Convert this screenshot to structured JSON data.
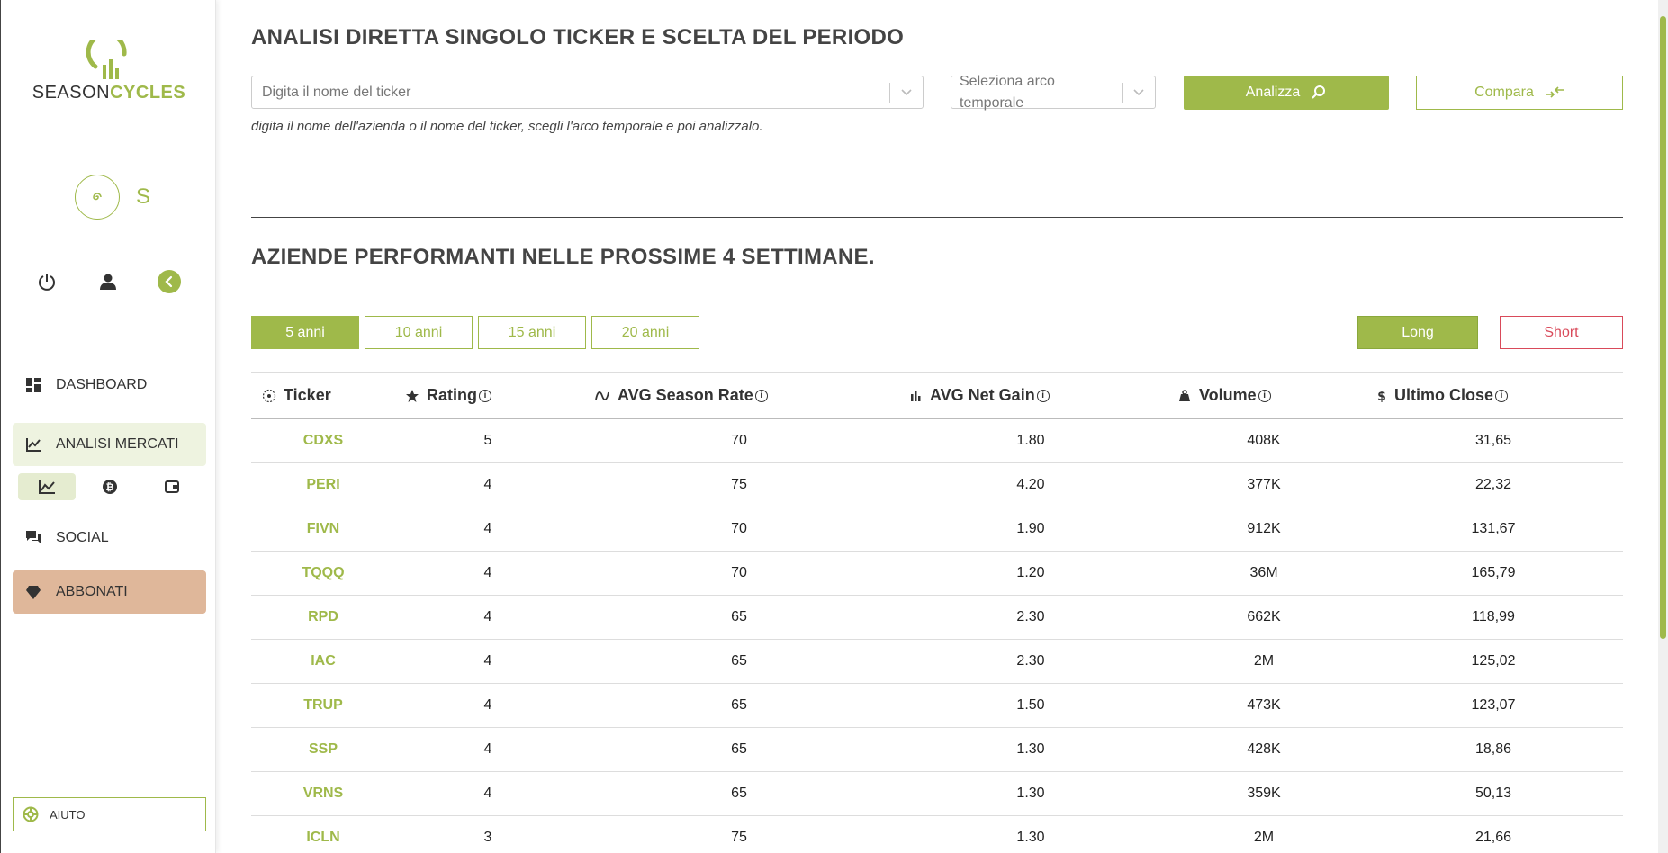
{
  "brand": {
    "name_part1": "SEASON",
    "name_part2": "CYCLES"
  },
  "user": {
    "initial": "S"
  },
  "nav": {
    "dashboard": "DASHBOARD",
    "analisi_mercati": "ANALISI MERCATI",
    "social": "SOCIAL",
    "abbonati": "ABBONATI",
    "help": "AIUTO"
  },
  "search": {
    "title": "ANALISI DIRETTA SINGOLO TICKER E SCELTA DEL PERIODO",
    "ticker_placeholder": "Digita il nome del ticker",
    "period_placeholder_line1": "Seleziona arco",
    "period_placeholder_line2": "temporale",
    "analyze_label": "Analizza",
    "compare_label": "Compara",
    "hint": "digita il nome dell'azienda o il nome del ticker, scegli l'arco temporale e poi analizzalo."
  },
  "performers": {
    "title": "AZIENDE PERFORMANTI NELLE PROSSIME 4 SETTIMANE.",
    "periods": [
      "5 anni",
      "10 anni",
      "15 anni",
      "20 anni"
    ],
    "active_period": "5 anni",
    "long_label": "Long",
    "short_label": "Short",
    "columns": {
      "ticker": "Ticker",
      "rating": "Rating",
      "season_rate": "AVG Season Rate",
      "net_gain": "AVG Net Gain",
      "volume": "Volume",
      "close": "Ultimo Close"
    },
    "rows": [
      {
        "ticker": "CDXS",
        "rating": "5",
        "season_rate": "70",
        "net_gain": "1.80",
        "volume": "408K",
        "close": "31,65"
      },
      {
        "ticker": "PERI",
        "rating": "4",
        "season_rate": "75",
        "net_gain": "4.20",
        "volume": "377K",
        "close": "22,32"
      },
      {
        "ticker": "FIVN",
        "rating": "4",
        "season_rate": "70",
        "net_gain": "1.90",
        "volume": "912K",
        "close": "131,67"
      },
      {
        "ticker": "TQQQ",
        "rating": "4",
        "season_rate": "70",
        "net_gain": "1.20",
        "volume": "36M",
        "close": "165,79"
      },
      {
        "ticker": "RPD",
        "rating": "4",
        "season_rate": "65",
        "net_gain": "2.30",
        "volume": "662K",
        "close": "118,99"
      },
      {
        "ticker": "IAC",
        "rating": "4",
        "season_rate": "65",
        "net_gain": "2.30",
        "volume": "2M",
        "close": "125,02"
      },
      {
        "ticker": "TRUP",
        "rating": "4",
        "season_rate": "65",
        "net_gain": "1.50",
        "volume": "473K",
        "close": "123,07"
      },
      {
        "ticker": "SSP",
        "rating": "4",
        "season_rate": "65",
        "net_gain": "1.30",
        "volume": "428K",
        "close": "18,86"
      },
      {
        "ticker": "VRNS",
        "rating": "4",
        "season_rate": "65",
        "net_gain": "1.30",
        "volume": "359K",
        "close": "50,13"
      },
      {
        "ticker": "ICLN",
        "rating": "3",
        "season_rate": "75",
        "net_gain": "1.30",
        "volume": "2M",
        "close": "21,66"
      }
    ]
  },
  "colors": {
    "accent": "#9fb94a",
    "short": "#d94a5a",
    "abbonati_bg": "#dfb79a"
  }
}
